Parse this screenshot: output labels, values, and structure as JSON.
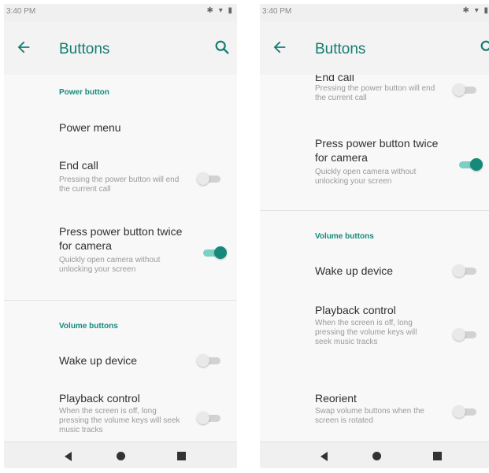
{
  "status": {
    "time": "3:40 PM",
    "icons": "✱ ▾ ▮"
  },
  "app": {
    "title": "Buttons"
  },
  "sections": {
    "power": "Power button",
    "volume": "Volume buttons"
  },
  "settings": {
    "power_menu": {
      "title": "Power menu"
    },
    "end_call": {
      "title": "End call",
      "subtitle": "Pressing the power button will end the current call",
      "enabled": false
    },
    "camera": {
      "title": "Press power button twice for camera",
      "subtitle": "Quickly open camera without unlocking your screen",
      "enabled": true
    },
    "wake": {
      "title": "Wake up device",
      "enabled": false
    },
    "playback": {
      "title": "Playback control",
      "subtitle": "When the screen is off, long pressing the volume keys will seek music tracks",
      "enabled": false
    },
    "reorient": {
      "title": "Reorient",
      "subtitle": "Swap volume buttons when the screen is rotated",
      "enabled": false
    }
  },
  "colors": {
    "accent": "#17897b",
    "title": "#147d70",
    "track_on": "#7ccfc3"
  },
  "icons": {
    "back": "arrow-left-icon",
    "search": "search-icon",
    "nav_back": "triangle-back-icon",
    "nav_home": "circle-home-icon",
    "nav_recents": "square-recents-icon"
  }
}
